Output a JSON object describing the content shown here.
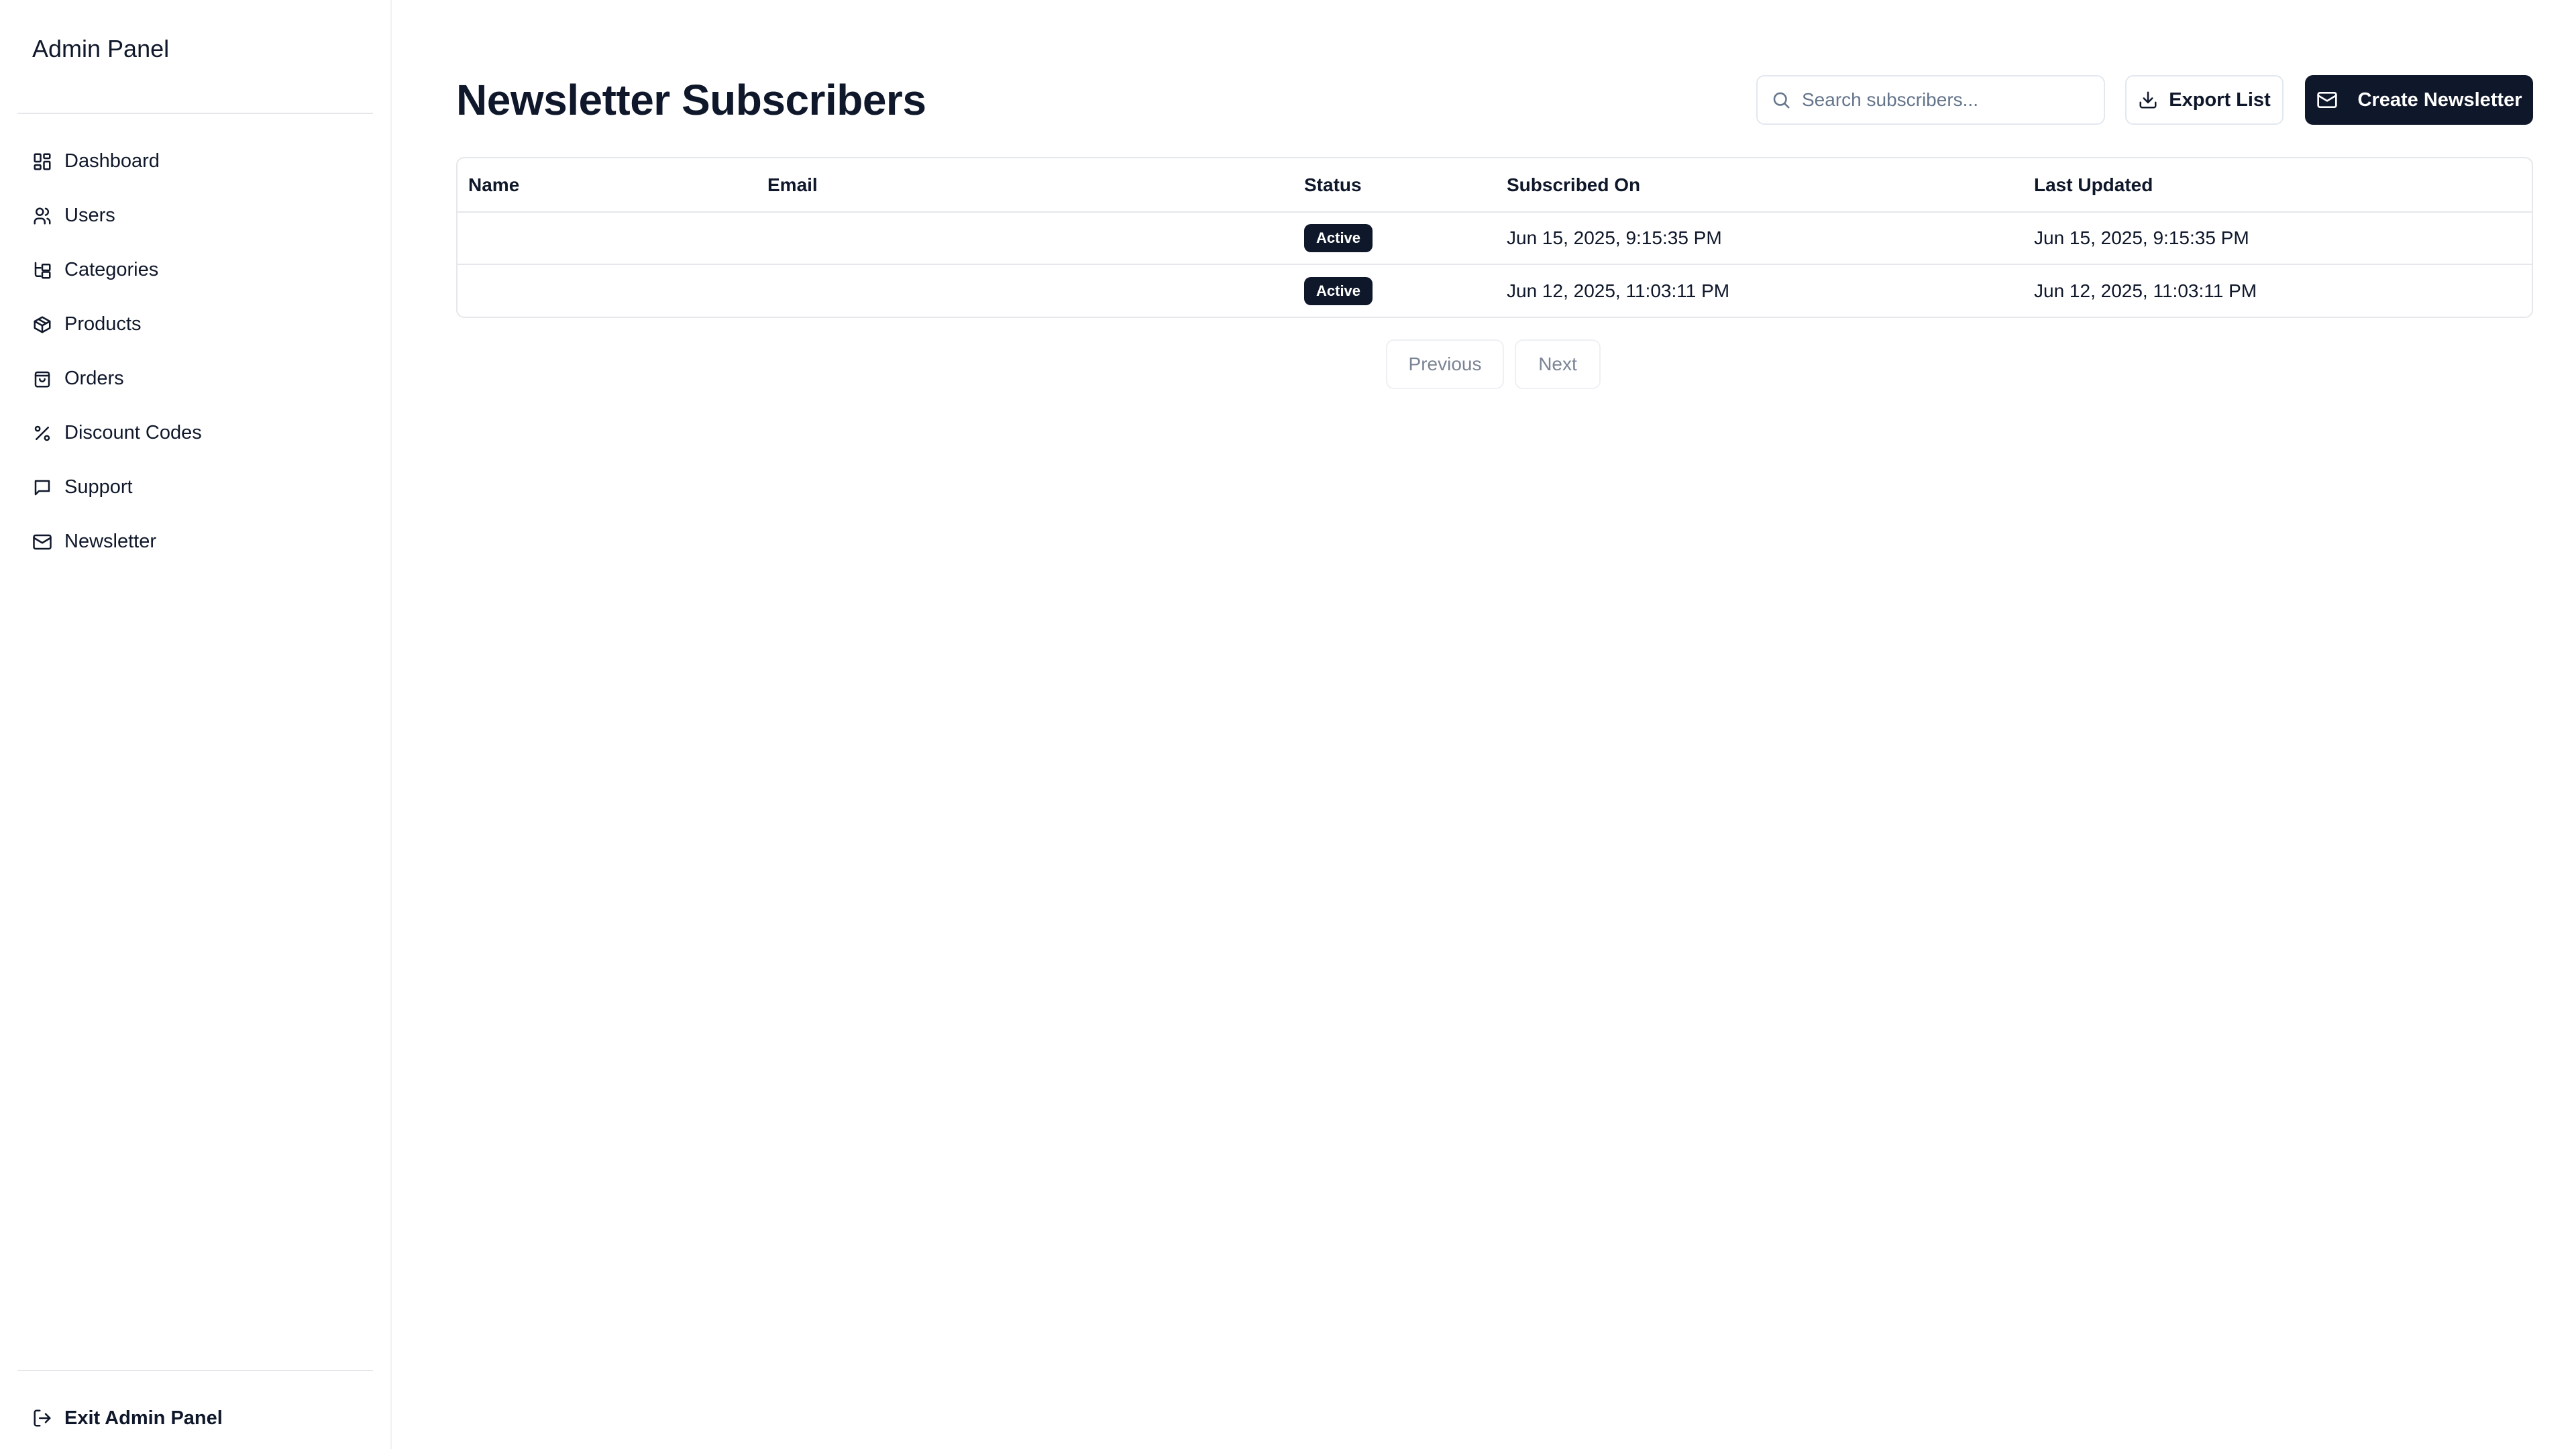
{
  "sidebar": {
    "brand": "Admin Panel",
    "items": [
      {
        "label": "Dashboard",
        "icon": "dashboard-icon"
      },
      {
        "label": "Users",
        "icon": "users-icon"
      },
      {
        "label": "Categories",
        "icon": "categories-icon"
      },
      {
        "label": "Products",
        "icon": "box-icon"
      },
      {
        "label": "Orders",
        "icon": "shopping-bag-icon"
      },
      {
        "label": "Discount Codes",
        "icon": "percent-icon"
      },
      {
        "label": "Support",
        "icon": "message-icon"
      },
      {
        "label": "Newsletter",
        "icon": "mail-icon"
      }
    ],
    "exit_label": "Exit Admin Panel"
  },
  "header": {
    "title": "Newsletter Subscribers",
    "search_placeholder": "Search subscribers...",
    "search_value": "",
    "export_label": "Export List",
    "create_label": "Create Newsletter"
  },
  "table": {
    "columns": [
      "Name",
      "Email",
      "Status",
      "Subscribed On",
      "Last Updated"
    ],
    "rows": [
      {
        "name": "",
        "email": "",
        "status": "Active",
        "subscribed_on": "Jun 15, 2025, 9:15:35 PM",
        "last_updated": "Jun 15, 2025, 9:15:35 PM"
      },
      {
        "name": "",
        "email": "",
        "status": "Active",
        "subscribed_on": "Jun 12, 2025, 11:03:11 PM",
        "last_updated": "Jun 12, 2025, 11:03:11 PM"
      }
    ]
  },
  "pagination": {
    "previous_label": "Previous",
    "next_label": "Next"
  },
  "colors": {
    "primary": "#0f172a",
    "border": "#e5e7eb",
    "muted_text": "#64748b"
  }
}
